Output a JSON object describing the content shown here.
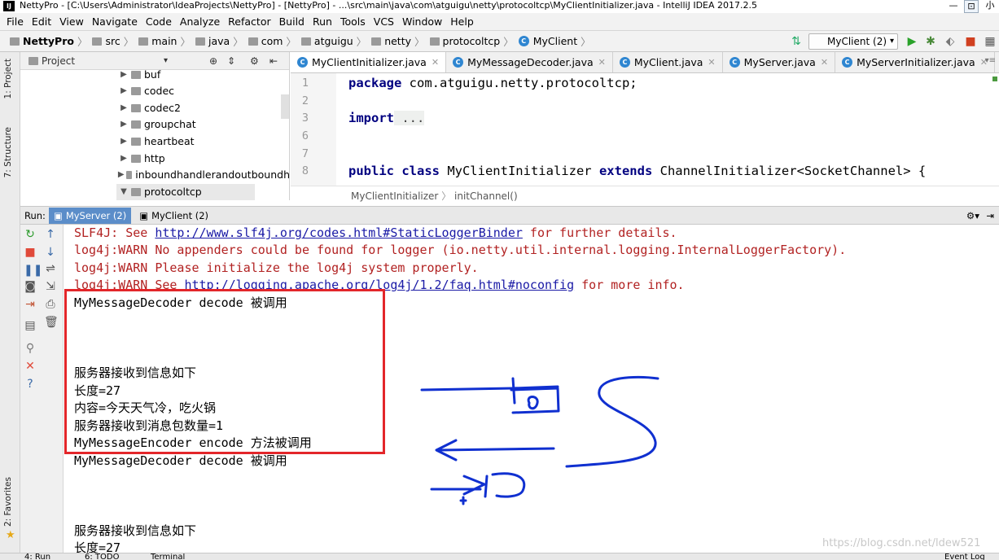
{
  "window": {
    "title": "NettyPro - [C:\\Users\\Administrator\\IdeaProjects\\NettyPro] - [NettyPro] - ...\\src\\main\\java\\com\\atguigu\\netty\\protocoltcp\\MyClientInitializer.java - IntelliJ IDEA 2017.2.5",
    "corner_text": "小"
  },
  "menu": [
    "File",
    "Edit",
    "View",
    "Navigate",
    "Code",
    "Analyze",
    "Refactor",
    "Build",
    "Run",
    "Tools",
    "VCS",
    "Window",
    "Help"
  ],
  "breadcrumb": [
    "NettyPro",
    "src",
    "main",
    "java",
    "com",
    "atguigu",
    "netty",
    "protocoltcp",
    "MyClient"
  ],
  "run_config": "MyClient (2)",
  "left_strip": {
    "project": "1: Project",
    "structure": "7: Structure",
    "favorites": "2: Favorites"
  },
  "project_panel": {
    "title": "Project",
    "items": [
      "buf",
      "codec",
      "codec2",
      "groupchat",
      "heartbeat",
      "http",
      "inboundhandlerandoutboundh",
      "protocoltcp"
    ]
  },
  "editor_tabs": [
    "MyClientInitializer.java",
    "MyMessageDecoder.java",
    "MyClient.java",
    "MyServer.java",
    "MyServerInitializer.java"
  ],
  "editor": {
    "line_numbers": [
      "1",
      "2",
      "3",
      "6",
      "7",
      "8"
    ],
    "line1_kw": "package",
    "line1_rest": " com.atguigu.netty.protocoltcp;",
    "line3_kw": "import",
    "line3_rest": " ...",
    "line8_kw1": "public class",
    "line8_mid": " MyClientInitializer ",
    "line8_kw2": "extends",
    "line8_rest": " ChannelInitializer<SocketChannel> {"
  },
  "editor_breadcrumb": [
    "MyClientInitializer",
    "initChannel()"
  ],
  "run_panel": {
    "label": "Run:",
    "tabs": [
      "MyServer (2)",
      "MyClient (2)"
    ]
  },
  "console": {
    "slf4j_prefix": "SLF4J: See ",
    "slf4j_link": "http://www.slf4j.org/codes.html#StaticLoggerBinder",
    "slf4j_suffix": " for further details.",
    "warn1": "log4j:WARN No appenders could be found for logger (io.netty.util.internal.logging.InternalLoggerFactory).",
    "warn2": "log4j:WARN Please initialize the log4j system properly.",
    "warn3_prefix": "log4j:WARN See ",
    "warn3_link": "http://logging.apache.org/log4j/1.2/faq.html#noconfig",
    "warn3_suffix": " for more info.",
    "lines": [
      "MyMessageDecoder decode 被调用",
      "服务器接收到信息如下",
      "长度=27",
      "内容=今天天气冷，吃火锅",
      "服务器接收到消息包数量=1",
      "MyMessageEncoder encode 方法被调用",
      "MyMessageDecoder decode 被调用",
      "服务器接收到信息如下",
      "长度=27"
    ]
  },
  "bottom_tabs": [
    "4: Run",
    "6: TODO",
    "Terminal",
    "Event Log"
  ],
  "watermark": "https://blog.csdn.net/ldew521",
  "colors": {
    "highlight_box": "#e3262a",
    "ink": "#1030d0",
    "keyword": "#000080",
    "warn_text": "#b22222"
  }
}
